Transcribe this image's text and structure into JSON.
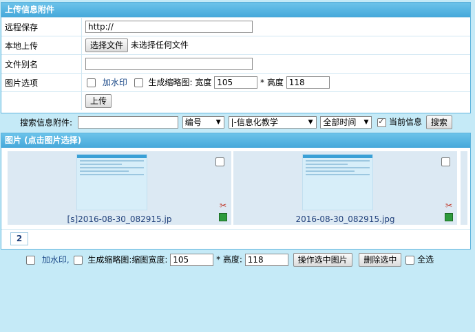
{
  "upload": {
    "title": "上传信息附件",
    "remote_label": "远程保存",
    "remote_value": "http://",
    "local_label": "本地上传",
    "choose_btn": "选择文件",
    "no_file": "未选择任何文件",
    "alias_label": "文件别名",
    "options_label": "图片选项",
    "watermark": "加水印",
    "thumb": "生成缩略图:",
    "width_label": "宽度",
    "width_value": "105",
    "height_label": "* 高度",
    "height_value": "118",
    "upload_btn": "上传"
  },
  "search": {
    "label": "搜索信息附件:",
    "keyword": "",
    "field_select": "编号",
    "class_select": "|-信息化教学",
    "time_select": "全部时间",
    "current_label": "当前信息",
    "current_checked": true,
    "search_btn": "搜索"
  },
  "gallery": {
    "title": "图片 (点击图片选择)",
    "items": [
      {
        "caption": "[s]2016-08-30_082915.jp"
      },
      {
        "caption": "2016-08-30_082915.jpg"
      }
    ],
    "page": "2"
  },
  "bottom": {
    "watermark": "加水印,",
    "thumb_label": "生成缩略图:缩图宽度:",
    "width_value": "105",
    "height_label": "* 高度:",
    "height_value": "118",
    "apply_btn": "操作选中图片",
    "delete_btn": "删除选中",
    "select_all": "全选"
  }
}
